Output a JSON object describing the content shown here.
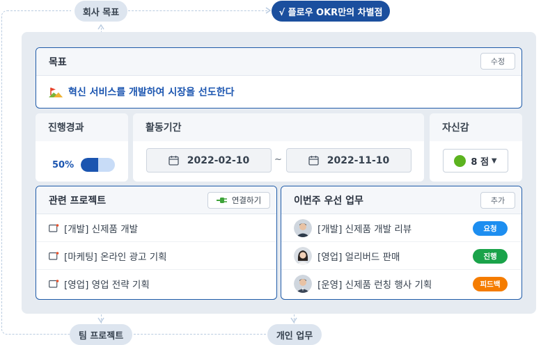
{
  "top_labels": {
    "company_goal": "회사 목표",
    "okr_difference": "√ 플로우 OKR만의 차별점"
  },
  "bottom_labels": {
    "team_project": "팀 프로젝트",
    "personal_task": "개인 업무"
  },
  "goal": {
    "header": "목표",
    "edit_label": "수정",
    "text": "혁신 서비스를 개발하여 시장을 선도한다"
  },
  "progress": {
    "header": "진행경과",
    "percent_label": "50%",
    "value": 0.5
  },
  "period": {
    "header": "활동기간",
    "start": "2022-02-10",
    "separator": "~",
    "end": "2022-11-10"
  },
  "confidence": {
    "header": "자신감",
    "value": "8 점",
    "color": "#5cb31f"
  },
  "projects": {
    "header": "관련 프로젝트",
    "connect_label": "연결하기",
    "items": [
      {
        "label": "[개발] 신제품 개발"
      },
      {
        "label": "[마케팅] 온라인 광고 기획"
      },
      {
        "label": "[영업] 영업 전략 기획"
      }
    ]
  },
  "tasks": {
    "header": "이번주 우선 업무",
    "add_label": "추가",
    "items": [
      {
        "label": "[개발] 신제품 개발 리뷰",
        "status": "요청",
        "color": "#1d8ef0"
      },
      {
        "label": "[영업] 얼리버드 판매",
        "status": "진행",
        "color": "#1aa34a"
      },
      {
        "label": "[운영] 신제품 런칭 행사 기획",
        "status": "피드백",
        "color": "#f57c00"
      }
    ]
  },
  "colors": {
    "accent": "#1b55b0",
    "border": "#1e5aa8"
  }
}
